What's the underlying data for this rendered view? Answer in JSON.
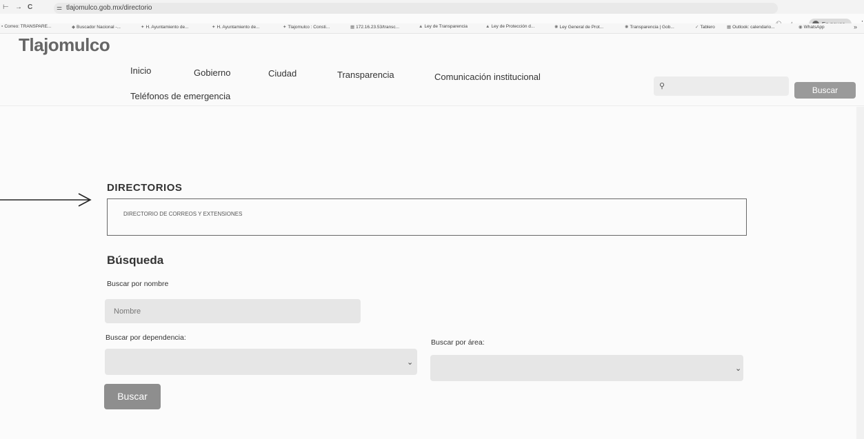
{
  "browser": {
    "url": "tlajomulco.gob.mx/directorio",
    "profile_status": "En pausa",
    "bookmarks": [
      "Correo: TRANSPARE...",
      "Buscador Nacional -...",
      "H. Ayuntamiento de...",
      "H. Ayuntamiento de...",
      "Tlajomulco : Consti...",
      "172.16.23.53/transc...",
      "Ley de Transparencia",
      "Ley de Protección d...",
      "Ley General de Prot...",
      "Transparencia | Gob...",
      "Tablero",
      "Outlook: calendario...",
      "WhatsApp"
    ]
  },
  "header": {
    "logo_text": "Tlajomulco",
    "nav": [
      "Inicio",
      "Gobierno",
      "Ciudad",
      "Transparencia",
      "Comunicación institucional",
      "Teléfonos de emergencia"
    ],
    "search_button": "Buscar"
  },
  "main": {
    "section_title": "DIRECTORIOS",
    "directory_item": "DIRECTORIO DE CORREOS Y EXTENSIONES",
    "search_heading": "Búsqueda",
    "name_label": "Buscar por nombre",
    "name_placeholder": "Nombre",
    "dependencia_label": "Buscar por dependencia:",
    "area_label": "Buscar por área:",
    "submit_label": "Buscar"
  }
}
